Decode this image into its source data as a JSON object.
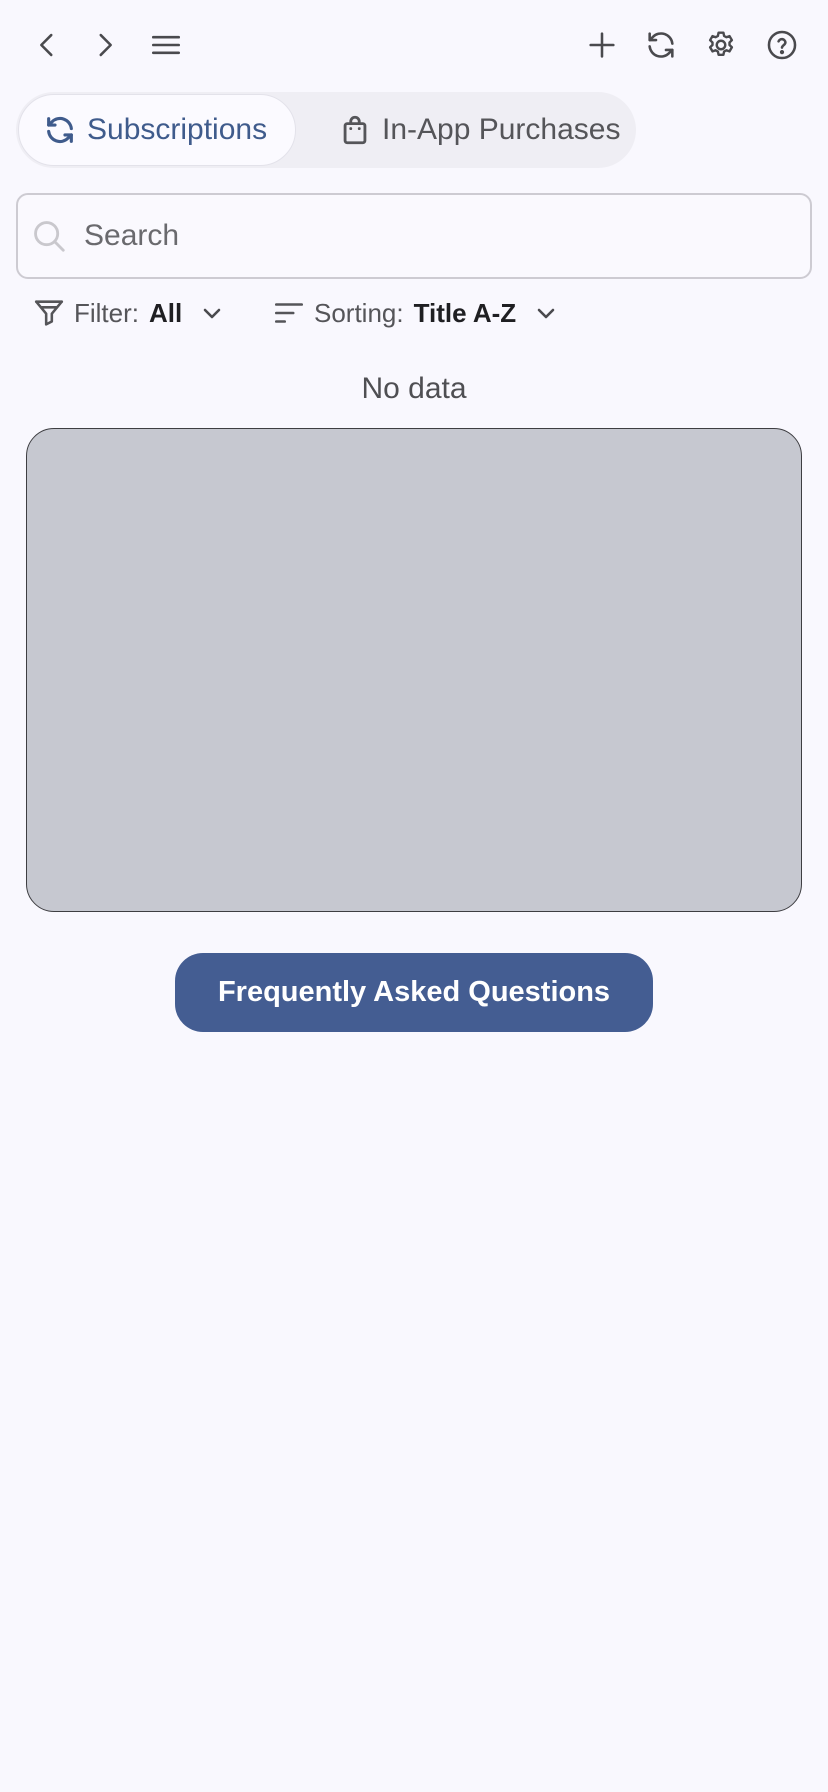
{
  "toolbar": {
    "back_icon": "chevron-left-icon",
    "forward_icon": "chevron-right-icon",
    "menu_icon": "menu-icon",
    "add_icon": "plus-icon",
    "refresh_icon": "refresh-icon",
    "settings_icon": "gear-icon",
    "help_icon": "help-circle-icon"
  },
  "tabs": [
    {
      "label": "Subscriptions",
      "icon": "refresh-icon",
      "active": true
    },
    {
      "label": "In-App Purchases",
      "icon": "shopping-bag-icon",
      "active": false
    }
  ],
  "search": {
    "placeholder": "Search",
    "value": ""
  },
  "filter": {
    "label": "Filter:",
    "value": "All"
  },
  "sorting": {
    "label": "Sorting:",
    "value": "Title A-Z"
  },
  "empty_state": {
    "text": "No data"
  },
  "faq_button": {
    "label": "Frequently Asked Questions"
  },
  "colors": {
    "background": "#f9f8fe",
    "accent": "#3f5b8c",
    "button": "#445d92",
    "placeholder_box": "#c6c8d0"
  }
}
